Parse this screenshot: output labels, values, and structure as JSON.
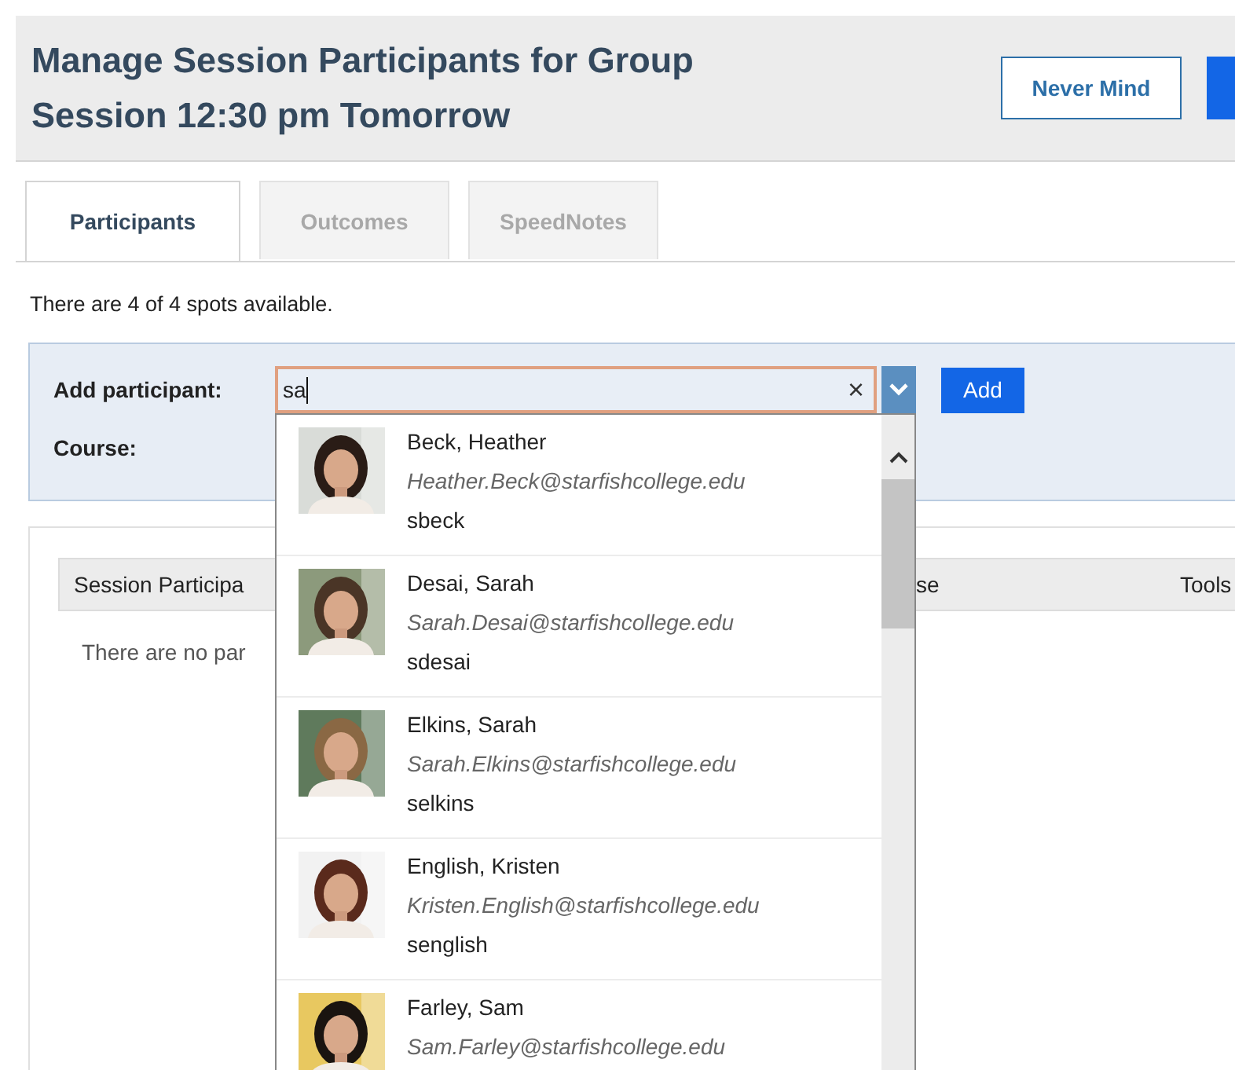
{
  "header": {
    "title": "Manage Session Participants for Group Session 12:30 pm Tomorrow",
    "buttons": [
      {
        "kind": "secondary",
        "label": "Never Mind"
      },
      {
        "kind": "primary"
      }
    ]
  },
  "tabs": [
    {
      "label": "Participants",
      "selected": true
    },
    {
      "label": "Outcomes",
      "selected": false
    },
    {
      "label": "SpeedNotes",
      "selected": false
    }
  ],
  "availability": "There are 4 of 4 spots available.",
  "form": {
    "add_label": "Add participant:",
    "value": "sa",
    "clear": "×",
    "add_button": "Add",
    "course_label": "Course:"
  },
  "suggestions": [
    {
      "name": "Beck, Heather",
      "email": "Heather.Beck@starfishcollege.edu",
      "username": "sbeck"
    },
    {
      "name": "Desai, Sarah",
      "email": "Sarah.Desai@starfishcollege.edu",
      "username": "sdesai"
    },
    {
      "name": "Elkins, Sarah",
      "email": "Sarah.Elkins@starfishcollege.edu",
      "username": "selkins"
    },
    {
      "name": "English, Kristen",
      "email": "Kristen.English@starfishcollege.edu",
      "username": "senglish"
    },
    {
      "name": "Farley, Sam",
      "email": "Sam.Farley@starfishcollege.edu"
    }
  ],
  "table": {
    "columns": [
      "Session Participa",
      "se",
      "Tools"
    ],
    "empty_message": "There are no par"
  }
}
